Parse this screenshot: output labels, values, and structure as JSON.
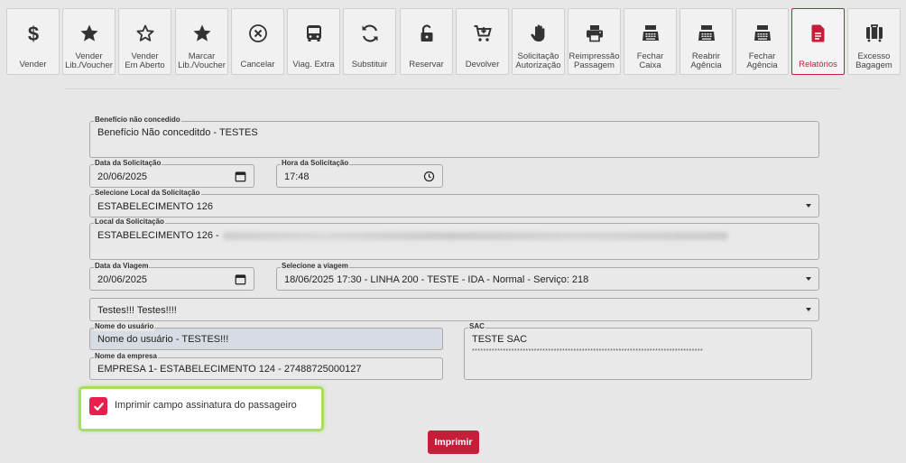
{
  "toolbar": {
    "buttons": [
      {
        "label": "Vender",
        "icon": "dollar-icon"
      },
      {
        "label": "Vender\nLib./Voucher",
        "icon": "star-filled-icon"
      },
      {
        "label": "Vender\nEm Aberto",
        "icon": "star-outline-icon"
      },
      {
        "label": "Marcar\nLib./Voucher",
        "icon": "star-filled-icon"
      },
      {
        "label": "Cancelar",
        "icon": "close-circle-icon"
      },
      {
        "label": "Viag. Extra",
        "icon": "bus-icon"
      },
      {
        "label": "Substituir",
        "icon": "sync-icon"
      },
      {
        "label": "Reservar",
        "icon": "unlock-icon"
      },
      {
        "label": "Devolver",
        "icon": "cart-return-icon"
      },
      {
        "label": "Solicitação\nAutorização",
        "icon": "hand-icon"
      },
      {
        "label": "Reimpressão\nPassagem",
        "icon": "printer-icon"
      },
      {
        "label": "Fechar\nCaixa",
        "icon": "cash-register-icon"
      },
      {
        "label": "Reabrir\nAgência",
        "icon": "cash-register-icon"
      },
      {
        "label": "Fechar\nAgência",
        "icon": "cash-register-icon"
      },
      {
        "label": "Relatórios",
        "icon": "report-icon",
        "active": true
      },
      {
        "label": "Excesso\nBagagem",
        "icon": "luggage-icon"
      }
    ]
  },
  "form": {
    "beneficio": {
      "label": "Benefício não concedido",
      "value": "Benefício Não conceditdo - TESTES"
    },
    "data_solicitacao": {
      "label": "Data da Solicitação",
      "value": "20/06/2025"
    },
    "hora_solicitacao": {
      "label": "Hora da Solicitação",
      "value": "17:48"
    },
    "local_select": {
      "label": "Selecione Local da Solicitação",
      "value": "ESTABELECIMENTO 126"
    },
    "local": {
      "label": "Local da Solicitação",
      "value": "ESTABELECIMENTO 126 -"
    },
    "data_viagem": {
      "label": "Data da Viagem",
      "value": "20/06/2025"
    },
    "viagem_select": {
      "label": "Selecione a viagem",
      "value": "18/06/2025 17:30 - LINHA 200 - TESTE - IDA - Normal - Serviço: 218"
    },
    "motivo_select": {
      "value": "Testes!!! Testes!!!!"
    },
    "nome_usuario": {
      "label": "Nome do usuário",
      "value": "Nome do usuário - TESTES!!!"
    },
    "nome_empresa": {
      "label": "Nome da empresa",
      "value": "EMPRESA 1- ESTABELECIMENTO 124 - 27488725000127"
    },
    "sac": {
      "label": "SAC",
      "value": "TESTE SAC",
      "mask": "**********************************************************************************"
    },
    "checkbox": {
      "label": "Imprimir campo assinatura do passageiro",
      "checked": true
    }
  },
  "actions": {
    "print_label": "Imprimir"
  },
  "colors": {
    "accent": "#c41e3a",
    "checkbox": "#e8204e",
    "highlight": "#a6e05a"
  }
}
